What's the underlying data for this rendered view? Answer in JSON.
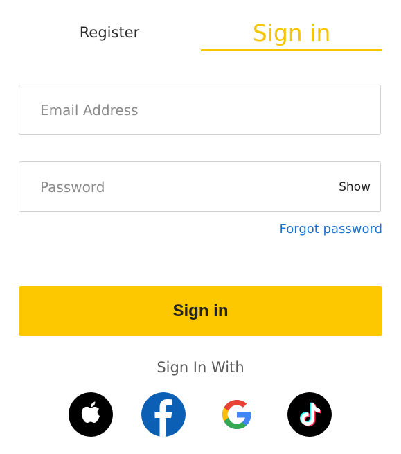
{
  "tabs": {
    "register_label": "Register",
    "signin_label": "Sign in",
    "active": "signin",
    "active_color": "#f7c500"
  },
  "form": {
    "email_placeholder": "Email Address",
    "email_value": "",
    "password_placeholder": "Password",
    "password_value": "",
    "show_label": "Show",
    "forgot_label": "Forgot password",
    "submit_label": "Sign in",
    "submit_color": "#fdc800"
  },
  "social": {
    "label": "Sign In With",
    "icons": [
      "apple-icon",
      "facebook-icon",
      "google-icon",
      "tiktok-icon"
    ]
  }
}
